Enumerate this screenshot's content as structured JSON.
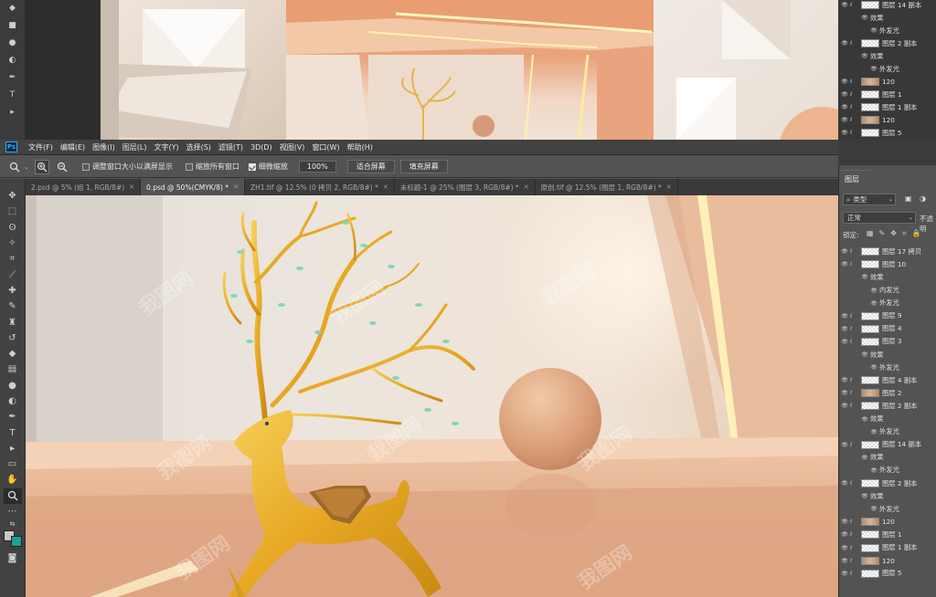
{
  "menubar": {
    "logo": "Ps",
    "items": [
      "文件(F)",
      "编辑(E)",
      "图像(I)",
      "图层(L)",
      "文字(Y)",
      "选择(S)",
      "滤镜(T)",
      "3D(D)",
      "视图(V)",
      "窗口(W)",
      "帮助(H)"
    ]
  },
  "options": {
    "resize_windows": "调整窗口大小以满屏显示",
    "zoom_all": "缩放所有窗口",
    "scrubby_zoom": "细微缩放",
    "zoom_value": "100%",
    "fit_screen": "适合屏幕",
    "fill_screen": "填充屏幕"
  },
  "tabs": [
    {
      "label": "2.psd @ 5% (组 1, RGB/8#)"
    },
    {
      "label": "0.psd @ 50%(CMYK/8) *"
    },
    {
      "label": "ZH1.tif @ 12.5% (0 拷贝 2, RGB/8#) *"
    },
    {
      "label": "未标题-1 @ 25% (图层 3, RGB/8#) *"
    },
    {
      "label": "原创.tif @ 12.5% (图层 1, RGB/8#) *"
    }
  ],
  "layers_panel": {
    "tab": "图层",
    "kind_filter": "类型",
    "blend_mode": "正常",
    "opacity_label": "不透明",
    "lock_label": "锁定:"
  },
  "top_layers": [
    {
      "name": "图层 14 副本",
      "type": "layer"
    },
    {
      "name": "效果",
      "type": "fx"
    },
    {
      "name": "外发光",
      "type": "effect"
    },
    {
      "name": "图层 2 副本",
      "type": "layer"
    },
    {
      "name": "效果",
      "type": "fx"
    },
    {
      "name": "外发光",
      "type": "effect"
    },
    {
      "name": "120",
      "type": "image"
    },
    {
      "name": "图层 1",
      "type": "layer"
    },
    {
      "name": "图层 1 副本",
      "type": "layer"
    },
    {
      "name": "120",
      "type": "image"
    },
    {
      "name": "图层 5",
      "type": "layer"
    }
  ],
  "layers": [
    {
      "name": "图层 17 拷贝",
      "type": "layer"
    },
    {
      "name": "图层 10",
      "type": "layer"
    },
    {
      "name": "效果",
      "type": "fx"
    },
    {
      "name": "内发光",
      "type": "effect"
    },
    {
      "name": "外发光",
      "type": "effect"
    },
    {
      "name": "图层 9",
      "type": "layer"
    },
    {
      "name": "图层 4",
      "type": "layer"
    },
    {
      "name": "图层 3",
      "type": "layer"
    },
    {
      "name": "效果",
      "type": "fx"
    },
    {
      "name": "外发光",
      "type": "effect"
    },
    {
      "name": "图层 4 副本",
      "type": "layer"
    },
    {
      "name": "图层 2",
      "type": "image"
    },
    {
      "name": "图层 2 副本",
      "type": "layer"
    },
    {
      "name": "效果",
      "type": "fx"
    },
    {
      "name": "外发光",
      "type": "effect"
    },
    {
      "name": "图层 14 副本",
      "type": "layer"
    },
    {
      "name": "效果",
      "type": "fx"
    },
    {
      "name": "外发光",
      "type": "effect"
    },
    {
      "name": "图层 2 副本",
      "type": "layer"
    },
    {
      "name": "效果",
      "type": "fx"
    },
    {
      "name": "外发光",
      "type": "effect"
    },
    {
      "name": "120",
      "type": "image"
    },
    {
      "name": "图层 1",
      "type": "layer"
    },
    {
      "name": "图层 1 副本",
      "type": "layer"
    },
    {
      "name": "120",
      "type": "image"
    },
    {
      "name": "图层 5",
      "type": "layer"
    }
  ],
  "watermark": "我图网"
}
